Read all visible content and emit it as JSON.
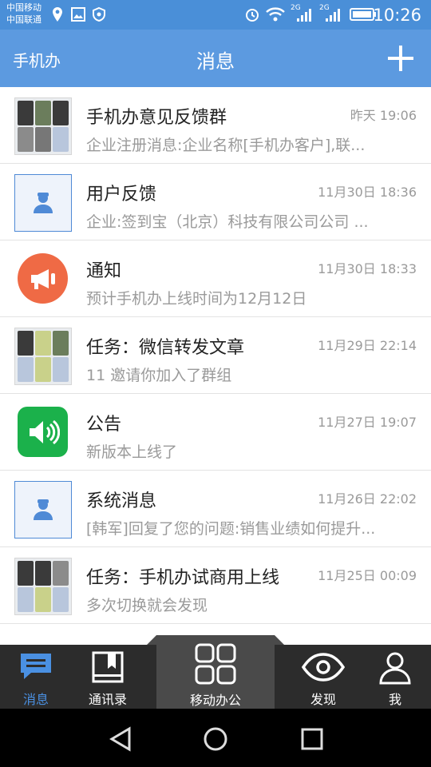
{
  "status_bar": {
    "carrier_1": "中国移动",
    "carrier_2": "中国联通",
    "network_1": "2G",
    "network_2": "2G",
    "time": "10:26",
    "icons": [
      "location-icon",
      "image-icon",
      "shield-icon",
      "alarm-icon",
      "wifi-icon",
      "signal-icon",
      "signal-icon",
      "battery-icon"
    ]
  },
  "header": {
    "left_label": "手机办",
    "title": "消息",
    "right_icon": "plus-icon"
  },
  "messages": [
    {
      "avatar": "group-avatar",
      "name": "手机办意见反馈群",
      "time": "昨天 19:06",
      "preview": "企业注册消息:企业名称[手机办客户],联..."
    },
    {
      "avatar": "person-icon",
      "name": "用户反馈",
      "time": "11月30日 18:36",
      "preview": "企业:签到宝（北京）科技有限公司公司 ..."
    },
    {
      "avatar": "megaphone-icon",
      "name": "通知",
      "time": "11月30日 18:33",
      "preview": "预计手机办上线时间为12月12日"
    },
    {
      "avatar": "group-avatar",
      "name": "任务：微信转发文章",
      "time": "11月29日 22:14",
      "preview": "11 邀请你加入了群组"
    },
    {
      "avatar": "speaker-icon",
      "name": "公告",
      "time": "11月27日 19:07",
      "preview": "新版本上线了"
    },
    {
      "avatar": "person-icon",
      "name": "系统消息",
      "time": "11月26日 22:02",
      "preview": "[韩军]回复了您的问题:销售业绩如何提升..."
    },
    {
      "avatar": "group-avatar",
      "name": "任务：手机办试商用上线",
      "time": "11月25日 00:09",
      "preview": "多次切换就会发现"
    }
  ],
  "tabs": [
    {
      "label": "消息",
      "icon": "chat-bubble-icon",
      "active": true
    },
    {
      "label": "通讯录",
      "icon": "contacts-book-icon",
      "active": false
    },
    {
      "label": "移动办公",
      "icon": "grid-apps-icon",
      "active": false
    },
    {
      "label": "发现",
      "icon": "eye-icon",
      "active": false
    },
    {
      "label": "我",
      "icon": "user-icon",
      "active": false
    }
  ],
  "nav_bar": {
    "icons": [
      "back-triangle-icon",
      "home-circle-icon",
      "recents-square-icon"
    ]
  },
  "colors": {
    "status_bar": "#4a8fd8",
    "app_bar": "#5c9ae0",
    "accent": "#4a90e2",
    "tab_bar": "#2c2c2c",
    "notice_avatar": "#ef6a45",
    "announce_avatar": "#1bb14b"
  }
}
